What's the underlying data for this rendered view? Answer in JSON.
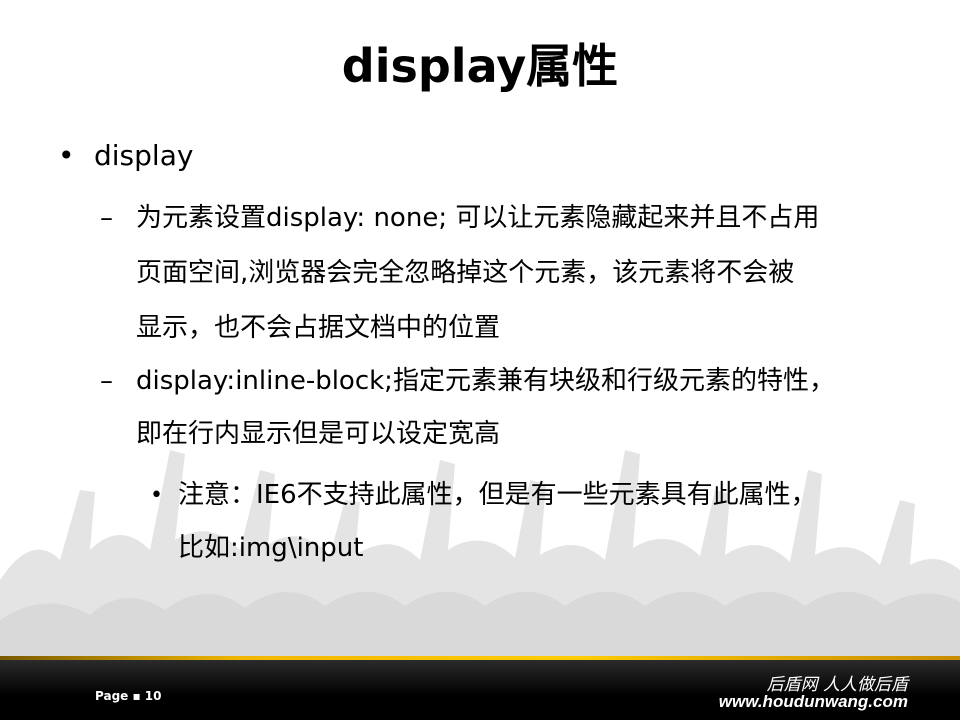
{
  "slide": {
    "title": "display属性",
    "bullet": "display",
    "items": [
      {
        "lines": [
          "为元素设置display: none; 可以让元素隐藏起来并且不占用",
          "页面空间,浏览器会完全忽略掉这个元素，该元素将不会被",
          "显示，也不会占据文档中的位置"
        ]
      },
      {
        "lines": [
          "display:inline-block;指定元素兼有块级和行级元素的特性，",
          "即在行内显示但是可以设定宽高"
        ]
      }
    ],
    "sub_items": [
      {
        "lines": [
          "注意：IE6不支持此属性，但是有一些元素具有此属性，",
          "比如:img\\input"
        ]
      }
    ]
  },
  "footer": {
    "page_label": "Page ▪ 10",
    "brand_cn": "后盾网 人人做后盾",
    "brand_url": "www.houdunwang.com"
  },
  "colors": {
    "accent_bar": "#ffcc00",
    "footer_bg": "#000000",
    "crowd": "#e6e6e6"
  }
}
